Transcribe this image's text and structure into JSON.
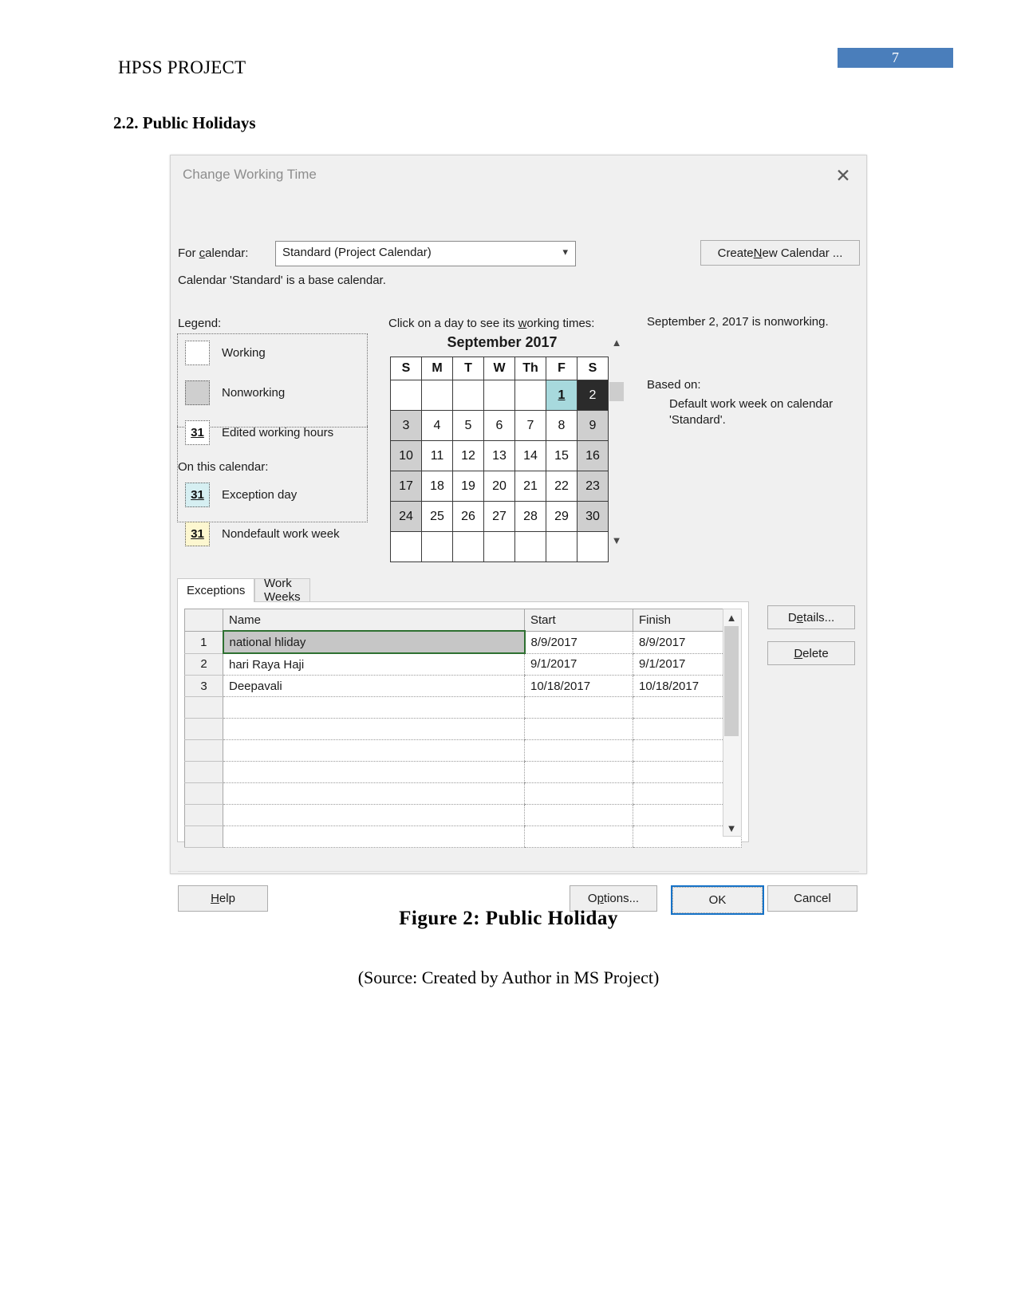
{
  "page": {
    "doc_title": "HPSS PROJECT",
    "page_number": "7",
    "section_title": "2.2. Public Holidays",
    "figure_caption": "Figure 2: Public Holiday",
    "source_caption": "(Source: Created by Author in MS Project)"
  },
  "dialog": {
    "title": "Change Working Time",
    "close_icon": "close-icon",
    "for_calendar_label": "For calendar:",
    "calendar_value": "Standard (Project Calendar)",
    "calendar_options": [
      "Standard (Project Calendar)"
    ],
    "create_new_label": "Create New Calendar ...",
    "base_note": "Calendar 'Standard' is a base calendar.",
    "legend": {
      "title": "Legend:",
      "on_this_calendar": "On this calendar:",
      "items": [
        {
          "label": "Working",
          "swatch_text": "",
          "swatch_color": "#ffffff"
        },
        {
          "label": "Nonworking",
          "swatch_text": "",
          "swatch_color": "#cfcfcf"
        },
        {
          "label": "Edited working hours",
          "swatch_text": "31",
          "swatch_color": "#ffffff"
        },
        {
          "label": "Exception day",
          "swatch_text": "31",
          "swatch_color": "#d6eff2"
        },
        {
          "label": "Nondefault work week",
          "swatch_text": "31",
          "swatch_color": "#fdf7d0"
        }
      ]
    },
    "calendar": {
      "hint": "Click on a day to see its working times:",
      "month_title": "September 2017",
      "weekday_headers": [
        "S",
        "M",
        "T",
        "W",
        "Th",
        "F",
        "S"
      ],
      "weeks": [
        [
          {
            "d": "",
            "state": "empty"
          },
          {
            "d": "",
            "state": "empty"
          },
          {
            "d": "",
            "state": "empty"
          },
          {
            "d": "",
            "state": "empty"
          },
          {
            "d": "",
            "state": "empty"
          },
          {
            "d": "1",
            "state": "exception"
          },
          {
            "d": "2",
            "state": "selected"
          }
        ],
        [
          {
            "d": "3",
            "state": "nonworking"
          },
          {
            "d": "4",
            "state": "working"
          },
          {
            "d": "5",
            "state": "working"
          },
          {
            "d": "6",
            "state": "working"
          },
          {
            "d": "7",
            "state": "working"
          },
          {
            "d": "8",
            "state": "working"
          },
          {
            "d": "9",
            "state": "nonworking"
          }
        ],
        [
          {
            "d": "10",
            "state": "nonworking"
          },
          {
            "d": "11",
            "state": "working"
          },
          {
            "d": "12",
            "state": "working"
          },
          {
            "d": "13",
            "state": "working"
          },
          {
            "d": "14",
            "state": "working"
          },
          {
            "d": "15",
            "state": "working"
          },
          {
            "d": "16",
            "state": "nonworking"
          }
        ],
        [
          {
            "d": "17",
            "state": "nonworking"
          },
          {
            "d": "18",
            "state": "working"
          },
          {
            "d": "19",
            "state": "working"
          },
          {
            "d": "20",
            "state": "working"
          },
          {
            "d": "21",
            "state": "working"
          },
          {
            "d": "22",
            "state": "working"
          },
          {
            "d": "23",
            "state": "nonworking"
          }
        ],
        [
          {
            "d": "24",
            "state": "nonworking"
          },
          {
            "d": "25",
            "state": "working"
          },
          {
            "d": "26",
            "state": "working"
          },
          {
            "d": "27",
            "state": "working"
          },
          {
            "d": "28",
            "state": "working"
          },
          {
            "d": "29",
            "state": "working"
          },
          {
            "d": "30",
            "state": "nonworking"
          }
        ],
        [
          {
            "d": "",
            "state": "empty"
          },
          {
            "d": "",
            "state": "empty"
          },
          {
            "d": "",
            "state": "empty"
          },
          {
            "d": "",
            "state": "empty"
          },
          {
            "d": "",
            "state": "empty"
          },
          {
            "d": "",
            "state": "empty"
          },
          {
            "d": "",
            "state": "empty"
          }
        ]
      ]
    },
    "info": {
      "status": "September 2, 2017 is nonworking.",
      "based_on_label": "Based on:",
      "based_on_detail": "Default work week on calendar 'Standard'."
    },
    "tabs": [
      {
        "label": "Exceptions",
        "active": true
      },
      {
        "label": "Work Weeks",
        "active": false
      }
    ],
    "exceptions_table": {
      "headers": [
        "",
        "Name",
        "Start",
        "Finish"
      ],
      "rows": [
        {
          "idx": "1",
          "name": "national hliday",
          "start": "8/9/2017",
          "finish": "8/9/2017",
          "selected": true
        },
        {
          "idx": "2",
          "name": "hari Raya Haji",
          "start": "9/1/2017",
          "finish": "9/1/2017",
          "selected": false
        },
        {
          "idx": "3",
          "name": "Deepavali",
          "start": "10/18/2017",
          "finish": "10/18/2017",
          "selected": false
        },
        {
          "idx": "",
          "name": "",
          "start": "",
          "finish": "",
          "selected": false
        },
        {
          "idx": "",
          "name": "",
          "start": "",
          "finish": "",
          "selected": false
        },
        {
          "idx": "",
          "name": "",
          "start": "",
          "finish": "",
          "selected": false
        },
        {
          "idx": "",
          "name": "",
          "start": "",
          "finish": "",
          "selected": false
        },
        {
          "idx": "",
          "name": "",
          "start": "",
          "finish": "",
          "selected": false
        },
        {
          "idx": "",
          "name": "",
          "start": "",
          "finish": "",
          "selected": false
        },
        {
          "idx": "",
          "name": "",
          "start": "",
          "finish": "",
          "selected": false
        }
      ]
    },
    "side_buttons": {
      "details": "Details...",
      "delete": "Delete"
    },
    "footer_buttons": {
      "help": "Help",
      "options": "Options...",
      "ok": "OK",
      "cancel": "Cancel"
    },
    "colors": {
      "accent_blue": "#4a7ebb",
      "exception_day": "#a7d9dd",
      "nonworking": "#cfcfcf",
      "selected_day": "#2b2b2b",
      "ok_focus_border": "#1673c8",
      "row_select_border": "#2e7031"
    }
  }
}
